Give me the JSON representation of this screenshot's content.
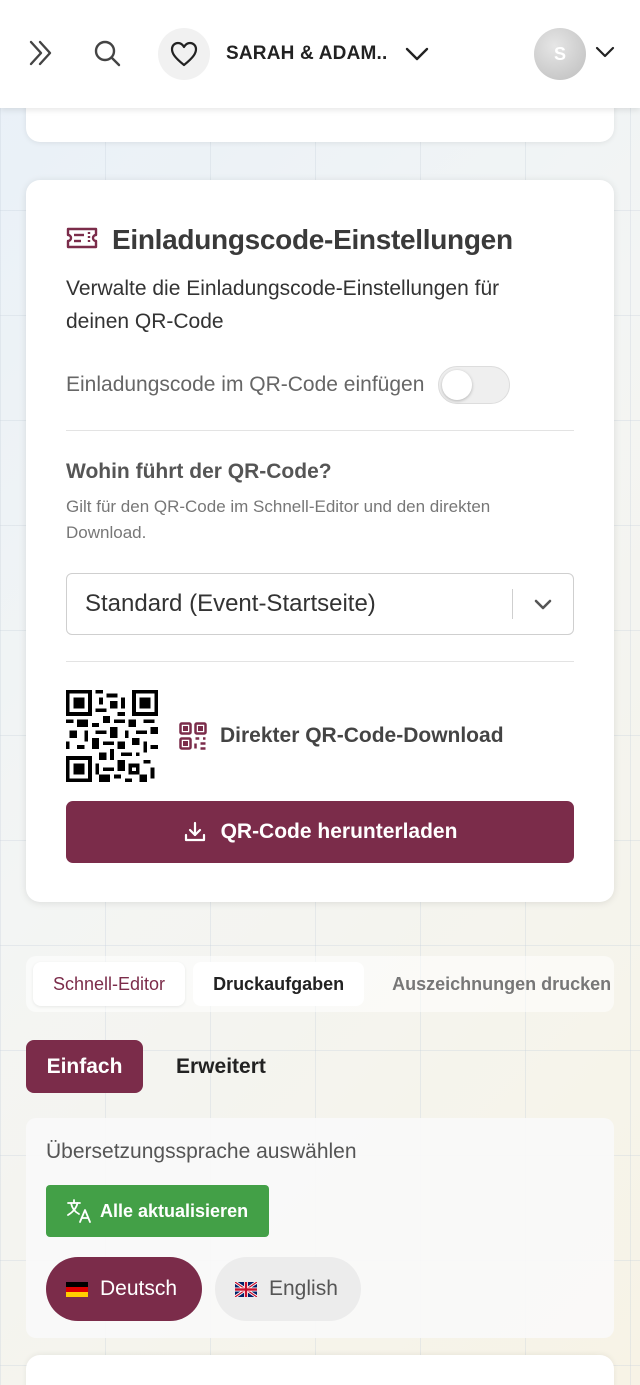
{
  "header": {
    "event_name": "SARAH & ADAM..."
  },
  "user": {
    "avatar_initial": "S"
  },
  "invite_settings": {
    "title": "Einladungscode-Einstellungen",
    "description": "Verwalte die Einladungscode-Einstellungen für deinen QR-Code",
    "toggle_label": "Einladungscode im QR-Code einfügen",
    "toggle_on": false,
    "question_title": "Wohin führt der QR-Code?",
    "question_hint": "Gilt für den QR-Code im Schnell-Editor und den direkten Download.",
    "select_value": "Standard (Event-Startseite)",
    "qr_download_label": "Direkter QR-Code-Download",
    "download_button": "QR-Code herunterladen"
  },
  "tabs": [
    {
      "label": "Schnell-Editor"
    },
    {
      "label": "Druckaufgaben"
    },
    {
      "label": "Auszeichnungen drucken"
    }
  ],
  "modes": {
    "simple": "Einfach",
    "advanced": "Erweitert"
  },
  "translation": {
    "title": "Übersetzungssprache auswählen",
    "update_all": "Alle aktualisieren",
    "languages": [
      {
        "label": "Deutsch",
        "selected": true
      },
      {
        "label": "English",
        "selected": false
      }
    ]
  },
  "colors": {
    "brand": "#7b2c4a",
    "success": "#43a047"
  }
}
